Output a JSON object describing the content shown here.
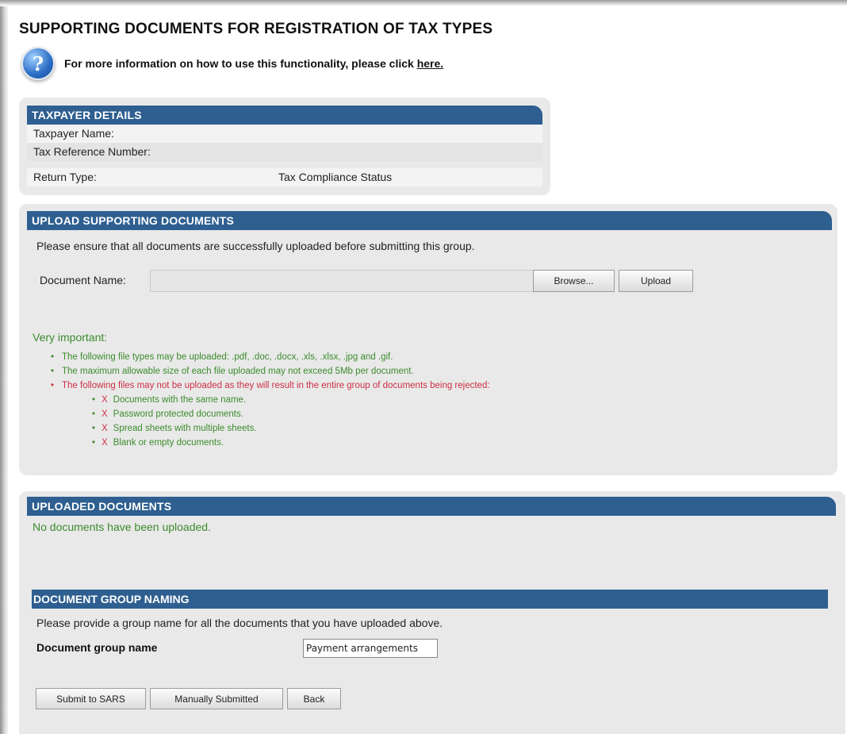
{
  "page": {
    "title": "SUPPORTING DOCUMENTS FOR REGISTRATION OF TAX TYPES",
    "help_text": "For more information on how to use this functionality, please click",
    "help_link": "here."
  },
  "taxpayer": {
    "header": "TAXPAYER DETAILS",
    "rows": [
      {
        "label": "Taxpayer Name:",
        "value": ""
      },
      {
        "label": "Tax Reference Number:",
        "value": ""
      },
      {
        "label": "Return Type:",
        "value": "Tax Compliance Status"
      }
    ]
  },
  "upload": {
    "header": "UPLOAD SUPPORTING DOCUMENTS",
    "instruction": "Please ensure that all documents are successfully uploaded before submitting this group.",
    "doc_name_label": "Document Name:",
    "doc_name_value": "",
    "browse_label": "Browse...",
    "upload_label": "Upload",
    "important_label": "Very important:",
    "rules": [
      "The following file types may be uploaded: .pdf, .doc, .docx, .xls, .xlsx, .jpg and .gif.",
      "The maximum allowable size of each file uploaded may not exceed 5Mb per document.",
      "The following files may not be uploaded as they will result in the entire group of documents being rejected:"
    ],
    "not_allowed": [
      "Documents with the same name.",
      "Password protected documents.",
      "Spread sheets with multiple sheets.",
      "Blank or empty documents."
    ],
    "x_mark": "X",
    "colors": {
      "allowed": "#3c8b2d",
      "forbidden": "#cc2f44"
    }
  },
  "uploaded": {
    "header": "UPLOADED DOCUMENTS",
    "empty_message": "No documents have been uploaded."
  },
  "group": {
    "header": "DOCUMENT GROUP NAMING",
    "instruction": "Please provide a group name for all the documents that you have uploaded above.",
    "name_label": "Document group name",
    "name_value": "Payment arrangements"
  },
  "actions": {
    "submit": "Submit to SARS",
    "manual": "Manually Submitted",
    "back": "Back"
  },
  "theme": {
    "header_blue": "#2e5f90",
    "panel_gray": "#e9e9e9"
  }
}
